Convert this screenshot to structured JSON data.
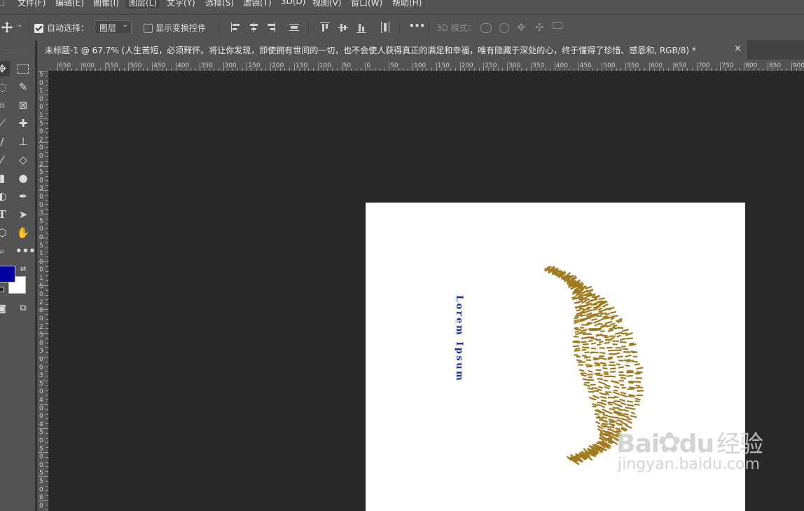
{
  "menu": {
    "items": [
      "文件(F)",
      "编辑(E)",
      "图像(I)",
      "图层(L)",
      "文字(Y)",
      "选择(S)",
      "滤镜(T)",
      "3D(D)",
      "视图(V)",
      "窗口(W)",
      "帮助(H)"
    ],
    "active_index": 3
  },
  "options": {
    "auto_select_label": "自动选择：",
    "auto_select_checked": true,
    "layer_dropdown": "图层",
    "show_transform_label": "显示变换控件",
    "show_transform_checked": false,
    "more": "•••",
    "mode3d_label": "3D 模式："
  },
  "tab": {
    "title": "未标题-1 @ 67.7% (人生苦短，必须释怀。将让你发现，即使拥有世间的一切，也不会使人获得真正的满足和幸福，唯有隐藏于深处的心，终于懂得了珍惜、感恩和, RGB/8) *",
    "close": "×"
  },
  "ruler": {
    "h_labels": [
      "650",
      "600",
      "550",
      "500",
      "450",
      "400",
      "350",
      "300",
      "250",
      "200",
      "150",
      "100",
      "50",
      "0",
      "50",
      "100",
      "150",
      "200",
      "250",
      "300",
      "350",
      "400",
      "450",
      "500",
      "550",
      "600",
      "650",
      "700",
      "750",
      "800",
      "850",
      "900"
    ],
    "v_labels": [
      "5",
      "0",
      "1",
      "0",
      "0",
      "1",
      "5",
      "0",
      "2",
      "0",
      "0",
      "2",
      "5",
      "0",
      "3",
      "0",
      "0",
      "3",
      "5",
      "0",
      "0",
      "5",
      "1",
      "0",
      "0",
      "1",
      "5",
      "0",
      "2",
      "0",
      "0",
      "2",
      "5",
      "0",
      "3",
      "0",
      "0",
      "3",
      "5",
      "0",
      "4",
      "0",
      "0",
      "4",
      "5",
      "0",
      "5",
      "0",
      "0",
      "5",
      "5",
      "0",
      "6",
      "0"
    ]
  },
  "colors": {
    "foreground": "#0000a0",
    "background": "#ffffff",
    "text_color": "#1a2aa6",
    "art_color": "#a07a1e"
  },
  "document": {
    "vertical_text": "Lorem Ipsum"
  },
  "watermark": {
    "brand": "Bai",
    "brand2": "du",
    "suffix": "经验",
    "url": "jingyan.baidu.com"
  }
}
